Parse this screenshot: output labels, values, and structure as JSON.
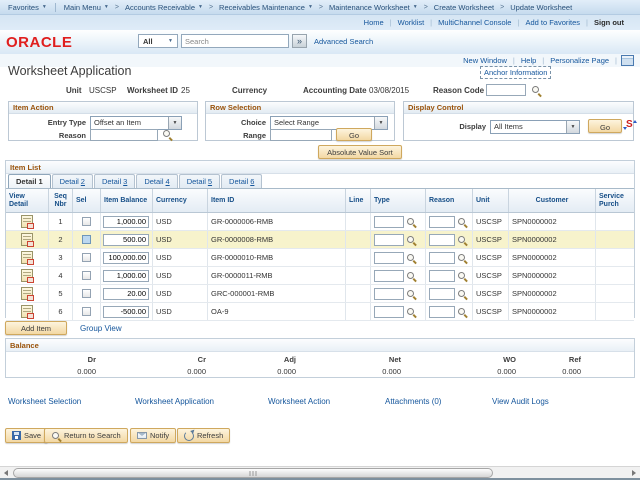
{
  "breadcrumb": {
    "favorites": "Favorites",
    "main_menu": "Main Menu",
    "path": [
      "Accounts Receivable",
      "Receivables Maintenance",
      "Maintenance Worksheet",
      "Create Worksheet",
      "Update Worksheet"
    ]
  },
  "portal_links": {
    "home": "Home",
    "worklist": "Worklist",
    "multichannel": "MultiChannel Console",
    "add_favorites": "Add to Favorites",
    "sign_out": "Sign out"
  },
  "brand": {
    "logo": "ORACLE"
  },
  "search": {
    "scope": "All",
    "placeholder": "Search",
    "go_glyph": "»",
    "advanced_label": "Advanced Search"
  },
  "page_links": {
    "new_window": "New Window",
    "help": "Help",
    "personalize": "Personalize Page"
  },
  "page": {
    "title": "Worksheet Application",
    "anchor_link": "Anchor Information"
  },
  "header_fields": {
    "unit_label": "Unit",
    "unit_value": "USCSP",
    "worksheet_id_label": "Worksheet ID",
    "worksheet_id_value": "25",
    "currency_label": "Currency",
    "currency_value": "",
    "accounting_date_label": "Accounting Date",
    "accounting_date_value": "03/08/2015",
    "reason_code_label": "Reason Code",
    "reason_code_value": ""
  },
  "item_action": {
    "title": "Item Action",
    "entry_type_label": "Entry Type",
    "entry_type_value": "Offset an Item",
    "reason_label": "Reason",
    "reason_value": ""
  },
  "row_selection": {
    "title": "Row Selection",
    "choice_label": "Choice",
    "choice_value": "Select Range",
    "range_label": "Range",
    "range_value": "",
    "go_label": "Go"
  },
  "display_control": {
    "title": "Display Control",
    "display_label": "Display",
    "display_value": "All Items",
    "go_label": "Go",
    "currency_icon_glyph": "S"
  },
  "sort_button_label": "Absolute Value Sort",
  "item_list": {
    "title": "Item List",
    "tabs": [
      {
        "word": "Detail",
        "num": "1",
        "active": true
      },
      {
        "word": "Detail",
        "num": "2",
        "active": false
      },
      {
        "word": "Detail",
        "num": "3",
        "active": false
      },
      {
        "word": "Detail",
        "num": "4",
        "active": false
      },
      {
        "word": "Detail",
        "num": "5",
        "active": false
      },
      {
        "word": "Detail",
        "num": "6",
        "active": false
      }
    ],
    "columns": [
      "View Detail",
      "Seq Nbr",
      "Sel",
      "Item Balance",
      "Currency",
      "Item ID",
      "Line",
      "Type",
      "Reason",
      "Unit",
      "Customer",
      "Service Purch"
    ],
    "rows": [
      {
        "seq": "1",
        "selected": false,
        "highlighted": false,
        "balance": "1,000.00",
        "currency": "USD",
        "item_id": "GR-0000006-RMB",
        "line": "",
        "type": "",
        "reason": "",
        "unit": "USCSP",
        "customer": "SPN0000002"
      },
      {
        "seq": "2",
        "selected": false,
        "highlighted": true,
        "balance": "500.00",
        "currency": "USD",
        "item_id": "GR-0000008-RMB",
        "line": "",
        "type": "",
        "reason": "",
        "unit": "USCSP",
        "customer": "SPN0000002"
      },
      {
        "seq": "3",
        "selected": false,
        "highlighted": false,
        "balance": "100,000.00",
        "currency": "USD",
        "item_id": "GR-0000010-RMB",
        "line": "",
        "type": "",
        "reason": "",
        "unit": "USCSP",
        "customer": "SPN0000002"
      },
      {
        "seq": "4",
        "selected": false,
        "highlighted": false,
        "balance": "1,000.00",
        "currency": "USD",
        "item_id": "GR-0000011-RMB",
        "line": "",
        "type": "",
        "reason": "",
        "unit": "USCSP",
        "customer": "SPN0000002"
      },
      {
        "seq": "5",
        "selected": false,
        "highlighted": false,
        "balance": "20.00",
        "currency": "USD",
        "item_id": "GRC-000001-RMB",
        "line": "",
        "type": "",
        "reason": "",
        "unit": "USCSP",
        "customer": "SPN0000002"
      },
      {
        "seq": "6",
        "selected": false,
        "highlighted": false,
        "balance": "-500.00",
        "currency": "USD",
        "item_id": "OA-9",
        "line": "",
        "type": "",
        "reason": "",
        "unit": "USCSP",
        "customer": "SPN0000002"
      }
    ],
    "add_item_label": "Add Item",
    "group_view_label": "Group View"
  },
  "balance": {
    "title": "Balance",
    "entries": [
      {
        "label": "Dr",
        "value": "0.000"
      },
      {
        "label": "Cr",
        "value": "0.000"
      },
      {
        "label": "Adj",
        "value": "0.000"
      },
      {
        "label": "Net",
        "value": "0.000"
      },
      {
        "label": "WO",
        "value": "0.000"
      },
      {
        "label": "Ref",
        "value": "0.000"
      }
    ]
  },
  "footer_links": [
    "Worksheet Selection",
    "Worksheet Application",
    "Worksheet Action",
    "Attachments (0)",
    "View Audit Logs"
  ],
  "toolbar": {
    "save": "Save",
    "return_to_search": "Return to Search",
    "notify": "Notify",
    "refresh": "Refresh"
  },
  "colors": {
    "oracle_red": "#e01e1e",
    "link_blue": "#15569c",
    "section_header_brown": "#9a530b",
    "button_gold": "#f3d8a4",
    "highlighted_row": "#f7f3cc"
  }
}
